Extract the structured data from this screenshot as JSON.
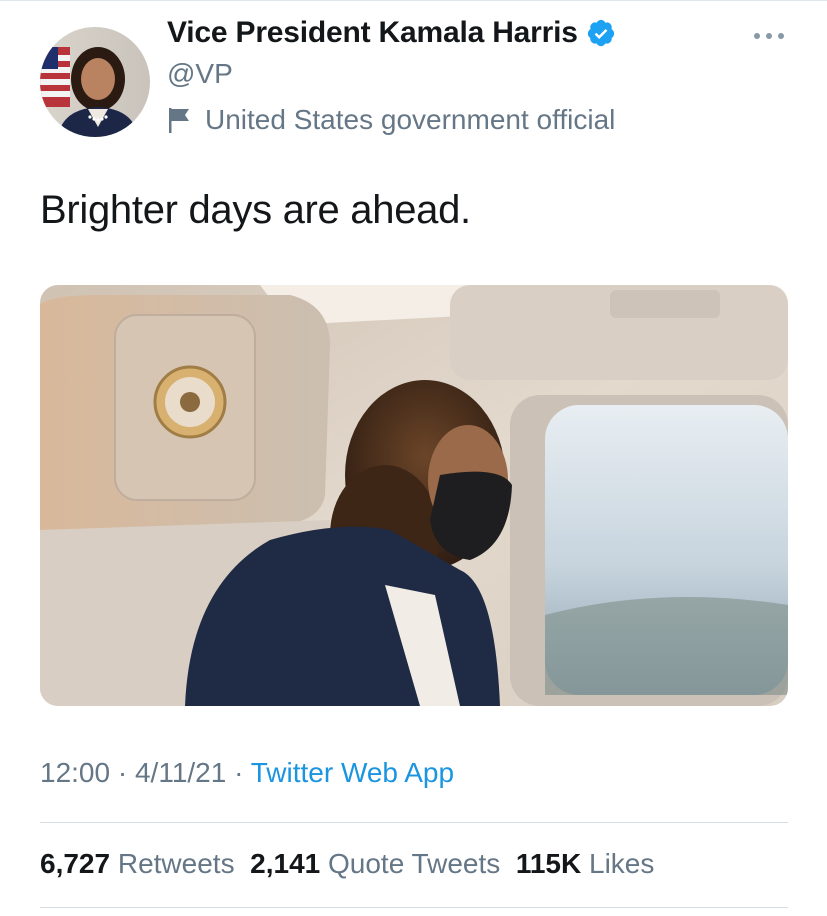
{
  "author": {
    "display_name": "Vice President Kamala Harris",
    "handle": "@VP",
    "label": "United States government official",
    "avatar_icon": "profile-photo",
    "verified_icon": "verified-badge-icon",
    "label_icon": "flag-icon"
  },
  "tweet": {
    "text": "Brighter days are ahead.",
    "media_description_icon": "photo"
  },
  "meta": {
    "time": "12:00",
    "date": "4/11/21",
    "source": "Twitter Web App",
    "separator": "·"
  },
  "stats": {
    "retweets_count": "6,727",
    "retweets_label": "Retweets",
    "quotes_count": "2,141",
    "quotes_label": "Quote Tweets",
    "likes_count": "115K",
    "likes_label": "Likes"
  },
  "colors": {
    "accent": "#1b95e0",
    "verified": "#1da1f2",
    "secondary_text": "#657786",
    "primary_text": "#14171a"
  }
}
